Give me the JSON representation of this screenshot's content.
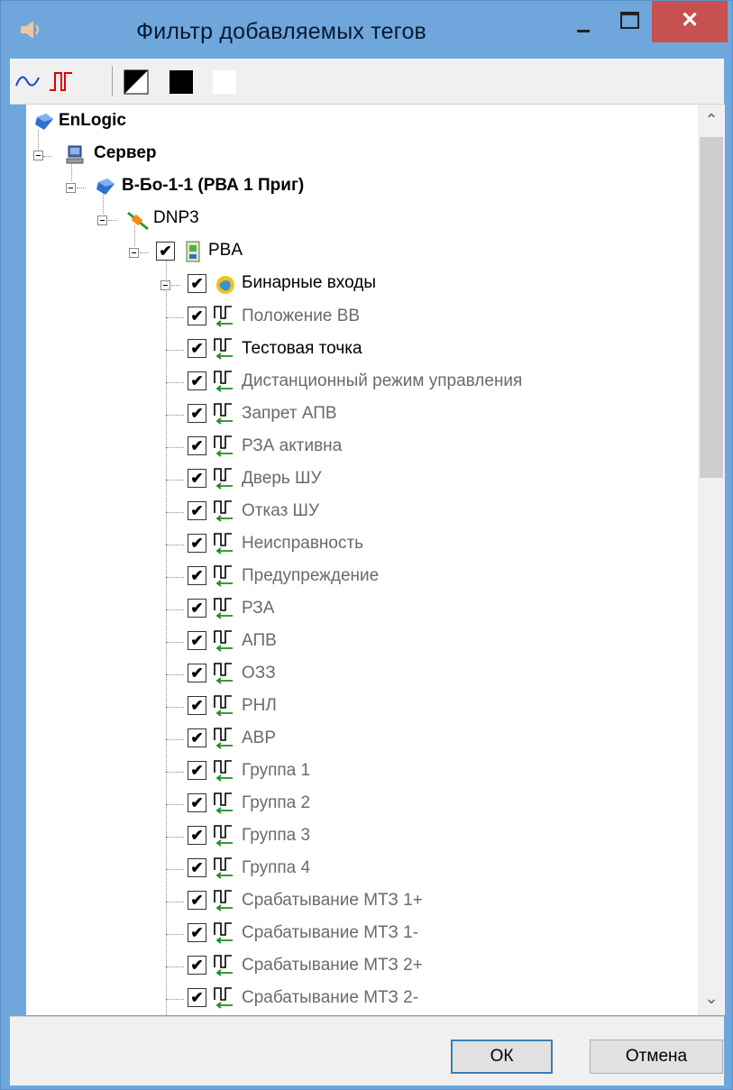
{
  "window": {
    "title": "Фильтр добавляемых тегов",
    "close_glyph": "✕"
  },
  "toolbar": {
    "buttons": [
      "analog-wave-icon",
      "digital-pulse-icon",
      "triangle-fill-icon",
      "black-square-icon",
      "white-square-icon"
    ]
  },
  "tree": {
    "root": "EnLogic",
    "server": "Сервер",
    "device": "В-Бо-1-1 (РВА 1 Приг)",
    "protocol": "DNP3",
    "unit": "PBA",
    "group": "Бинарные входы",
    "items": [
      {
        "label": "Положение ВВ",
        "active": false
      },
      {
        "label": "Тестовая точка",
        "active": true
      },
      {
        "label": "Дистанционный режим управления",
        "active": false
      },
      {
        "label": "Запрет АПВ",
        "active": false
      },
      {
        "label": "РЗА активна",
        "active": false
      },
      {
        "label": "Дверь ШУ",
        "active": false
      },
      {
        "label": "Отказ ШУ",
        "active": false
      },
      {
        "label": "Неисправность",
        "active": false
      },
      {
        "label": "Предупреждение",
        "active": false
      },
      {
        "label": "РЗА",
        "active": false
      },
      {
        "label": "АПВ",
        "active": false
      },
      {
        "label": "ОЗЗ",
        "active": false
      },
      {
        "label": "РНЛ",
        "active": false
      },
      {
        "label": "АВР",
        "active": false
      },
      {
        "label": "Группа 1",
        "active": false
      },
      {
        "label": "Группа 2",
        "active": false
      },
      {
        "label": "Группа 3",
        "active": false
      },
      {
        "label": "Группа 4",
        "active": false
      },
      {
        "label": "Срабатывание МТЗ 1+",
        "active": false
      },
      {
        "label": "Срабатывание МТЗ 1-",
        "active": false
      },
      {
        "label": "Срабатывание МТЗ 2+",
        "active": false
      },
      {
        "label": "Срабатывание МТЗ 2-",
        "active": false
      }
    ],
    "check_glyph": "✔"
  },
  "scrollbar": {
    "up_glyph": "⌃",
    "down_glyph": "⌄"
  },
  "footer": {
    "ok_label": "ОК",
    "cancel_label": "Отмена"
  },
  "colors": {
    "title_bar": "#6fa7dd",
    "close_button": "#c75050",
    "ok_border": "#3c7fb1",
    "item_arrow": "#1e8c1e"
  }
}
